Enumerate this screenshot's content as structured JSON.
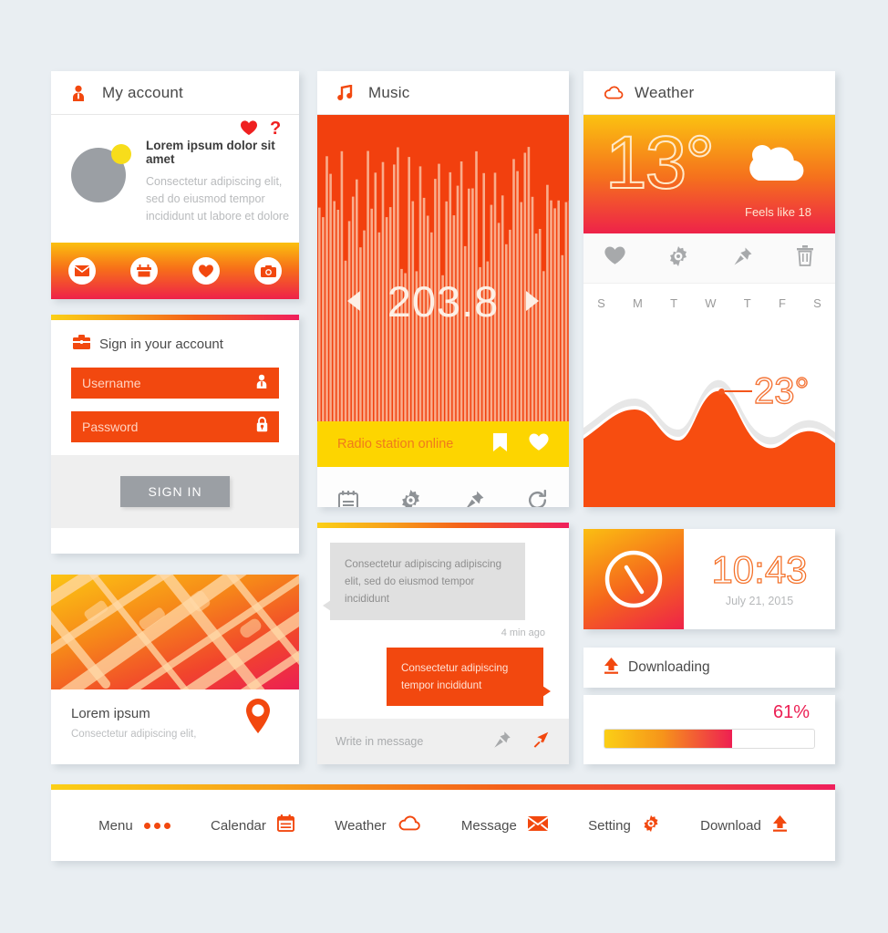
{
  "account": {
    "header_title": "My account",
    "header_icon": "user-icon",
    "name": "Lorem ipsum dolor sit amet",
    "description": "Consectetur adipiscing elit, sed do eiusmod tempor incididunt ut labore et dolore",
    "top_icons": [
      "heart-icon",
      "question-icon"
    ],
    "footer_icons": [
      "mail-icon",
      "calendar-icon",
      "heart-icon",
      "camera-icon"
    ]
  },
  "signin": {
    "header_title": "Sign in your account",
    "header_icon": "briefcase-icon",
    "username_placeholder": "Username",
    "username_icon": "user-icon",
    "password_placeholder": "Password",
    "password_icon": "lock-icon",
    "button_label": "SIGN IN"
  },
  "map": {
    "title": "Lorem ipsum",
    "subtitle": "Consectetur adipiscing elit,",
    "pin_icon": "location-pin-icon"
  },
  "music": {
    "header_title": "Music",
    "header_icon": "music-note-icon",
    "frequency": "203.8",
    "prev_icon": "previous-arrow-icon",
    "next_icon": "next-arrow-icon",
    "status": "Radio station online",
    "status_icons": [
      "bookmark-icon",
      "heart-icon"
    ],
    "footer_icons": [
      "calendar-icon",
      "gear-icon",
      "pin-icon",
      "refresh-icon"
    ]
  },
  "chat": {
    "incoming_message": "Consectetur adipiscing adipiscing elit, sed do eiusmod  tempor incididunt",
    "timestamp": "4 min ago",
    "outgoing_message": "Consectetur adipiscing tempor incididunt",
    "input_placeholder": "Write in message",
    "attach_icon": "pin-icon",
    "send_icon": "send-arrow-icon"
  },
  "weather": {
    "header_title": "Weather",
    "header_icon": "cloud-icon",
    "temperature": "13°",
    "condition_icon": "sun-cloud-icon",
    "feels_like": "Feels like 18",
    "action_icons": [
      "heart-icon",
      "gear-icon",
      "pin-icon",
      "trash-icon"
    ],
    "days": [
      "S",
      "M",
      "T",
      "W",
      "T",
      "F",
      "S"
    ],
    "peak_label": "23°"
  },
  "clock": {
    "icon": "clock-icon",
    "time": "10:43",
    "date": "July 21, 2015"
  },
  "download": {
    "title": "Downloading",
    "icon": "upload-arrow-icon",
    "percent_label": "61%",
    "percent_value": 61
  },
  "nav": {
    "items": [
      {
        "label": "Menu",
        "icon": "dots-icon"
      },
      {
        "label": "Calendar",
        "icon": "calendar-icon"
      },
      {
        "label": "Weather",
        "icon": "cloud-icon"
      },
      {
        "label": "Message",
        "icon": "mail-icon"
      },
      {
        "label": "Setting",
        "icon": "gear-icon"
      },
      {
        "label": "Download",
        "icon": "upload-arrow-icon"
      }
    ]
  },
  "colors": {
    "orange": "#f2480f",
    "yellow": "#fbcf16",
    "crimson": "#ee1f52",
    "gray": "#9b9fa4",
    "background": "#e9eef2"
  }
}
